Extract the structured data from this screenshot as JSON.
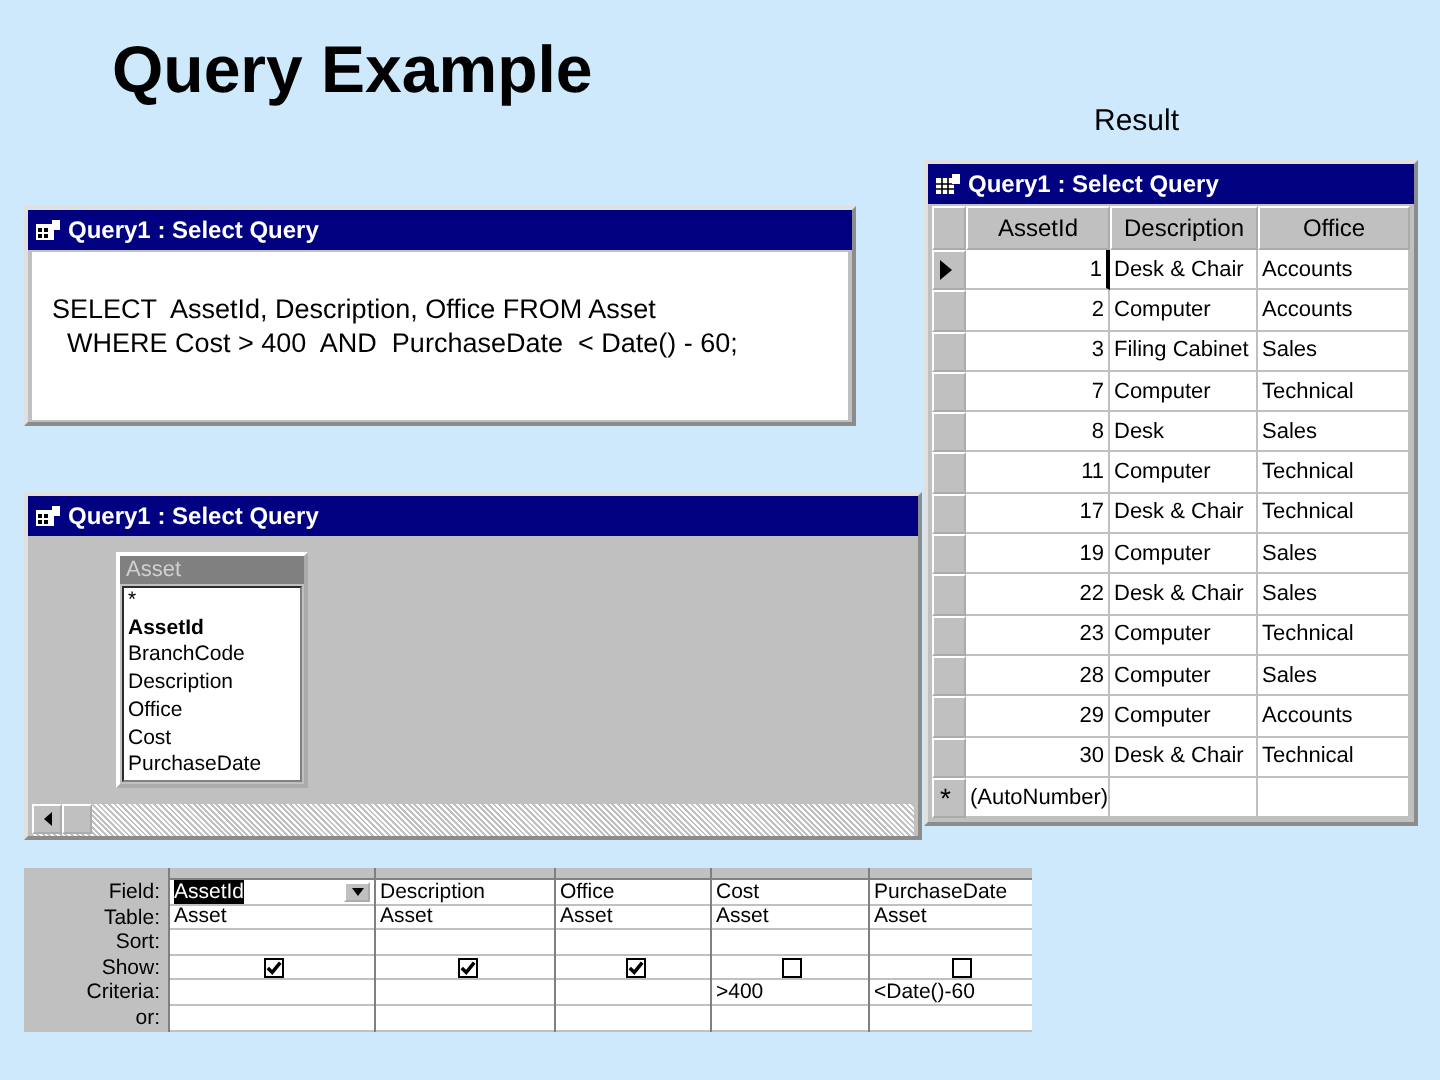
{
  "slide": {
    "title": "Query Example",
    "result_label": "Result"
  },
  "sql_window": {
    "title": "Query1 : Select Query",
    "lines": [
      "SELECT  AssetId, Description, Office FROM Asset",
      "  WHERE Cost > 400  AND  PurchaseDate  < Date() - 60;"
    ]
  },
  "design_window": {
    "title": "Query1 : Select Query",
    "table": {
      "name": "Asset",
      "fields": [
        {
          "name": "*",
          "primary_key": false
        },
        {
          "name": "AssetId",
          "primary_key": true
        },
        {
          "name": "BranchCode",
          "primary_key": false
        },
        {
          "name": "Description",
          "primary_key": false
        },
        {
          "name": "Office",
          "primary_key": false
        },
        {
          "name": "Cost",
          "primary_key": false
        },
        {
          "name": "PurchaseDate",
          "primary_key": false
        }
      ]
    }
  },
  "grid": {
    "row_labels": [
      "Field:",
      "Table:",
      "Sort:",
      "Show:",
      "Criteria:",
      "or:"
    ],
    "columns": [
      {
        "field": "AssetId",
        "table": "Asset",
        "show": true,
        "selected": true
      },
      {
        "field": "Description",
        "table": "Asset",
        "show": true,
        "selected": false
      },
      {
        "field": "Office",
        "table": "Asset",
        "show": true,
        "selected": false
      },
      {
        "field": "Cost",
        "table": "Asset",
        "show": false,
        "criteria": ">400",
        "selected": false
      },
      {
        "field": "PurchaseDate",
        "table": "Asset",
        "show": false,
        "criteria": "<Date()-60",
        "selected": false
      }
    ]
  },
  "result_window": {
    "title": "Query1 : Select Query",
    "columns": [
      "AssetId",
      "Description",
      "Office"
    ],
    "rows": [
      {
        "asset_id": "1",
        "description": "Desk & Chair",
        "office": "Accounts",
        "current": true
      },
      {
        "asset_id": "2",
        "description": "Computer",
        "office": "Accounts",
        "current": false
      },
      {
        "asset_id": "3",
        "description": "Filing Cabinet",
        "office": "Sales",
        "current": false
      },
      {
        "asset_id": "7",
        "description": "Computer",
        "office": "Technical",
        "current": false
      },
      {
        "asset_id": "8",
        "description": "Desk",
        "office": "Sales",
        "current": false
      },
      {
        "asset_id": "11",
        "description": "Computer",
        "office": "Technical",
        "current": false
      },
      {
        "asset_id": "17",
        "description": "Desk & Chair",
        "office": "Technical",
        "current": false
      },
      {
        "asset_id": "19",
        "description": "Computer",
        "office": "Sales",
        "current": false
      },
      {
        "asset_id": "22",
        "description": "Desk & Chair",
        "office": "Sales",
        "current": false
      },
      {
        "asset_id": "23",
        "description": "Computer",
        "office": "Technical",
        "current": false
      },
      {
        "asset_id": "28",
        "description": "Computer",
        "office": "Sales",
        "current": false
      },
      {
        "asset_id": "29",
        "description": "Computer",
        "office": "Accounts",
        "current": false
      },
      {
        "asset_id": "30",
        "description": "Desk & Chair",
        "office": "Technical",
        "current": false
      }
    ],
    "new_row": {
      "marker": "*",
      "asset_id": "(AutoNumber)"
    }
  }
}
